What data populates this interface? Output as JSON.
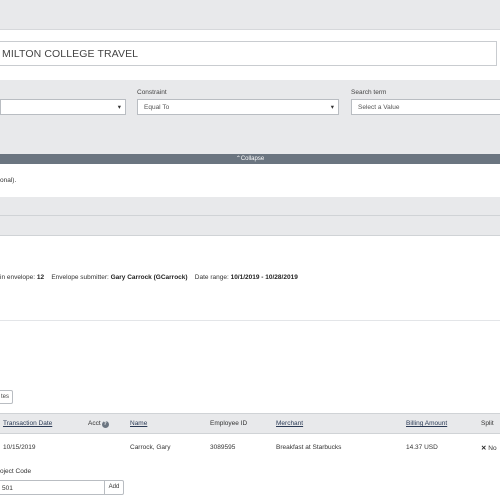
{
  "header": {
    "envelope_title": "MILTON COLLEGE TRAVEL"
  },
  "filters": {
    "field_value": "",
    "field_caret": "▾",
    "constraint_label": "Constraint",
    "constraint_value": "Equal To",
    "constraint_caret": "▾",
    "search_label": "Search term",
    "search_placeholder": "Select a Value"
  },
  "collapse_label": "⌃Collapse",
  "note_text": "onal).",
  "summary": {
    "count_label": "in envelope:",
    "count_value": "12",
    "submitter_label": "Envelope submitter:",
    "submitter_value": "Gary Carrock (GCarrock)",
    "range_label": "Date range:",
    "range_value": "10/1/2019 - 10/28/2019"
  },
  "small_button_label": "tes",
  "table": {
    "headers": {
      "transaction_date": "Transaction Date",
      "acct": "Acct",
      "acct_help": "?",
      "name": "Name",
      "employee_id": "Employee ID",
      "merchant": "Merchant",
      "billing_amount": "Billing Amount",
      "split": "Split"
    },
    "rows": [
      {
        "transaction_date": "10/15/2019",
        "name": "Carrock, Gary",
        "employee_id": "3089595",
        "merchant": "Breakfast at Starbucks",
        "billing_amount": "14.37 USD",
        "split_icon": "✕",
        "split_value": "No"
      }
    ]
  },
  "object_code": {
    "label": "oject Code",
    "value": "501",
    "add_label": "Add"
  }
}
